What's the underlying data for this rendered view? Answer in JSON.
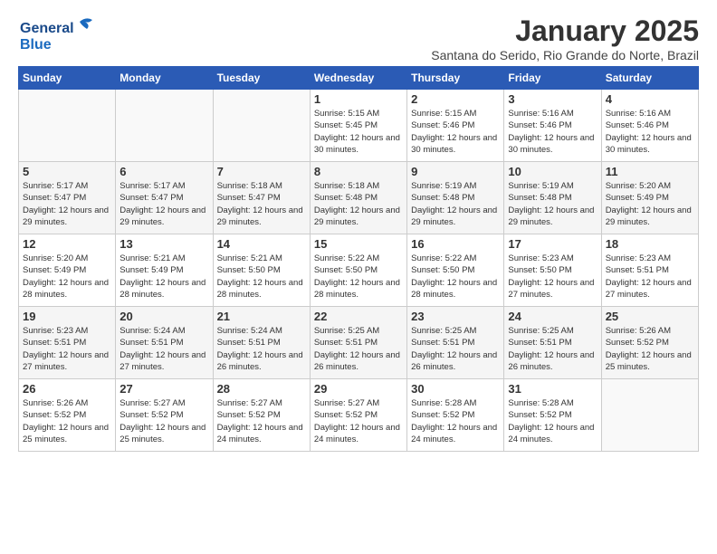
{
  "header": {
    "logo_line1": "General",
    "logo_line2": "Blue",
    "month_title": "January 2025",
    "subtitle": "Santana do Serido, Rio Grande do Norte, Brazil"
  },
  "weekdays": [
    "Sunday",
    "Monday",
    "Tuesday",
    "Wednesday",
    "Thursday",
    "Friday",
    "Saturday"
  ],
  "weeks": [
    [
      {
        "day": "",
        "sunrise": "",
        "sunset": "",
        "daylight": ""
      },
      {
        "day": "",
        "sunrise": "",
        "sunset": "",
        "daylight": ""
      },
      {
        "day": "",
        "sunrise": "",
        "sunset": "",
        "daylight": ""
      },
      {
        "day": "1",
        "sunrise": "Sunrise: 5:15 AM",
        "sunset": "Sunset: 5:45 PM",
        "daylight": "Daylight: 12 hours and 30 minutes."
      },
      {
        "day": "2",
        "sunrise": "Sunrise: 5:15 AM",
        "sunset": "Sunset: 5:46 PM",
        "daylight": "Daylight: 12 hours and 30 minutes."
      },
      {
        "day": "3",
        "sunrise": "Sunrise: 5:16 AM",
        "sunset": "Sunset: 5:46 PM",
        "daylight": "Daylight: 12 hours and 30 minutes."
      },
      {
        "day": "4",
        "sunrise": "Sunrise: 5:16 AM",
        "sunset": "Sunset: 5:46 PM",
        "daylight": "Daylight: 12 hours and 30 minutes."
      }
    ],
    [
      {
        "day": "5",
        "sunrise": "Sunrise: 5:17 AM",
        "sunset": "Sunset: 5:47 PM",
        "daylight": "Daylight: 12 hours and 29 minutes."
      },
      {
        "day": "6",
        "sunrise": "Sunrise: 5:17 AM",
        "sunset": "Sunset: 5:47 PM",
        "daylight": "Daylight: 12 hours and 29 minutes."
      },
      {
        "day": "7",
        "sunrise": "Sunrise: 5:18 AM",
        "sunset": "Sunset: 5:47 PM",
        "daylight": "Daylight: 12 hours and 29 minutes."
      },
      {
        "day": "8",
        "sunrise": "Sunrise: 5:18 AM",
        "sunset": "Sunset: 5:48 PM",
        "daylight": "Daylight: 12 hours and 29 minutes."
      },
      {
        "day": "9",
        "sunrise": "Sunrise: 5:19 AM",
        "sunset": "Sunset: 5:48 PM",
        "daylight": "Daylight: 12 hours and 29 minutes."
      },
      {
        "day": "10",
        "sunrise": "Sunrise: 5:19 AM",
        "sunset": "Sunset: 5:48 PM",
        "daylight": "Daylight: 12 hours and 29 minutes."
      },
      {
        "day": "11",
        "sunrise": "Sunrise: 5:20 AM",
        "sunset": "Sunset: 5:49 PM",
        "daylight": "Daylight: 12 hours and 29 minutes."
      }
    ],
    [
      {
        "day": "12",
        "sunrise": "Sunrise: 5:20 AM",
        "sunset": "Sunset: 5:49 PM",
        "daylight": "Daylight: 12 hours and 28 minutes."
      },
      {
        "day": "13",
        "sunrise": "Sunrise: 5:21 AM",
        "sunset": "Sunset: 5:49 PM",
        "daylight": "Daylight: 12 hours and 28 minutes."
      },
      {
        "day": "14",
        "sunrise": "Sunrise: 5:21 AM",
        "sunset": "Sunset: 5:50 PM",
        "daylight": "Daylight: 12 hours and 28 minutes."
      },
      {
        "day": "15",
        "sunrise": "Sunrise: 5:22 AM",
        "sunset": "Sunset: 5:50 PM",
        "daylight": "Daylight: 12 hours and 28 minutes."
      },
      {
        "day": "16",
        "sunrise": "Sunrise: 5:22 AM",
        "sunset": "Sunset: 5:50 PM",
        "daylight": "Daylight: 12 hours and 28 minutes."
      },
      {
        "day": "17",
        "sunrise": "Sunrise: 5:23 AM",
        "sunset": "Sunset: 5:50 PM",
        "daylight": "Daylight: 12 hours and 27 minutes."
      },
      {
        "day": "18",
        "sunrise": "Sunrise: 5:23 AM",
        "sunset": "Sunset: 5:51 PM",
        "daylight": "Daylight: 12 hours and 27 minutes."
      }
    ],
    [
      {
        "day": "19",
        "sunrise": "Sunrise: 5:23 AM",
        "sunset": "Sunset: 5:51 PM",
        "daylight": "Daylight: 12 hours and 27 minutes."
      },
      {
        "day": "20",
        "sunrise": "Sunrise: 5:24 AM",
        "sunset": "Sunset: 5:51 PM",
        "daylight": "Daylight: 12 hours and 27 minutes."
      },
      {
        "day": "21",
        "sunrise": "Sunrise: 5:24 AM",
        "sunset": "Sunset: 5:51 PM",
        "daylight": "Daylight: 12 hours and 26 minutes."
      },
      {
        "day": "22",
        "sunrise": "Sunrise: 5:25 AM",
        "sunset": "Sunset: 5:51 PM",
        "daylight": "Daylight: 12 hours and 26 minutes."
      },
      {
        "day": "23",
        "sunrise": "Sunrise: 5:25 AM",
        "sunset": "Sunset: 5:51 PM",
        "daylight": "Daylight: 12 hours and 26 minutes."
      },
      {
        "day": "24",
        "sunrise": "Sunrise: 5:25 AM",
        "sunset": "Sunset: 5:51 PM",
        "daylight": "Daylight: 12 hours and 26 minutes."
      },
      {
        "day": "25",
        "sunrise": "Sunrise: 5:26 AM",
        "sunset": "Sunset: 5:52 PM",
        "daylight": "Daylight: 12 hours and 25 minutes."
      }
    ],
    [
      {
        "day": "26",
        "sunrise": "Sunrise: 5:26 AM",
        "sunset": "Sunset: 5:52 PM",
        "daylight": "Daylight: 12 hours and 25 minutes."
      },
      {
        "day": "27",
        "sunrise": "Sunrise: 5:27 AM",
        "sunset": "Sunset: 5:52 PM",
        "daylight": "Daylight: 12 hours and 25 minutes."
      },
      {
        "day": "28",
        "sunrise": "Sunrise: 5:27 AM",
        "sunset": "Sunset: 5:52 PM",
        "daylight": "Daylight: 12 hours and 24 minutes."
      },
      {
        "day": "29",
        "sunrise": "Sunrise: 5:27 AM",
        "sunset": "Sunset: 5:52 PM",
        "daylight": "Daylight: 12 hours and 24 minutes."
      },
      {
        "day": "30",
        "sunrise": "Sunrise: 5:28 AM",
        "sunset": "Sunset: 5:52 PM",
        "daylight": "Daylight: 12 hours and 24 minutes."
      },
      {
        "day": "31",
        "sunrise": "Sunrise: 5:28 AM",
        "sunset": "Sunset: 5:52 PM",
        "daylight": "Daylight: 12 hours and 24 minutes."
      },
      {
        "day": "",
        "sunrise": "",
        "sunset": "",
        "daylight": ""
      }
    ]
  ]
}
